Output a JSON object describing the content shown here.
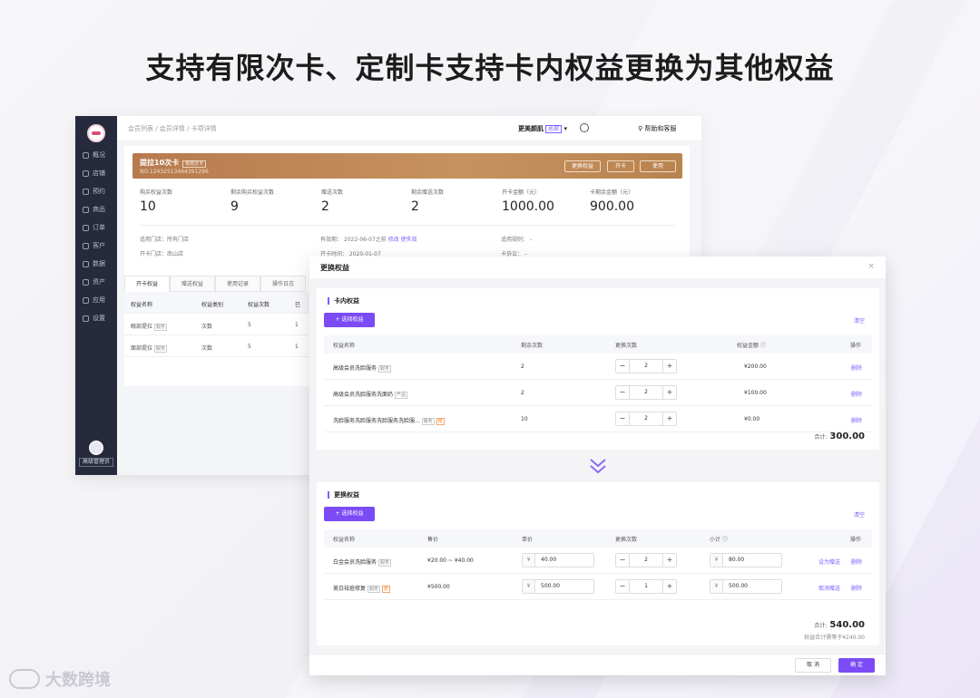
{
  "headline": "支持有限次卡、定制卡支持卡内权益更换为其他权益",
  "watermark": "大数跨境",
  "sidebar": {
    "items": [
      "概况",
      "店铺",
      "预约",
      "商品",
      "订单",
      "客户",
      "数据",
      "资产",
      "应用",
      "设置"
    ],
    "user_label": "高级管理员"
  },
  "topbar": {
    "breadcrumb": "会员列表 / 会员详情 / 卡项详情",
    "store_name": "更美颜肌",
    "store_tag": "总部",
    "help": "帮助和客服"
  },
  "card": {
    "title": "提拉10次卡",
    "tag": "有限次卡",
    "number": "NO.12432513464391296",
    "buttons": [
      "更换权益",
      "开卡",
      "使用"
    ],
    "stats": [
      {
        "label": "购买权益次数",
        "value": "10"
      },
      {
        "label": "剩余购买权益次数",
        "value": "9"
      },
      {
        "label": "赠送次数",
        "value": "2"
      },
      {
        "label": "剩余赠送次数",
        "value": "2"
      },
      {
        "label": "开卡金额（元）",
        "value": "1000.00"
      },
      {
        "label": "卡剩余金额（元）",
        "value": "900.00"
      }
    ],
    "info": {
      "applicable_store": "适用门店：所有门店",
      "open_store": "开卡门店：南山店",
      "validity": "有效期：   2022-06-07之前",
      "modify": "修改",
      "invalidate": "使失效",
      "open_time": "开卡时间：   2020-01-07",
      "rule": "适用规则：   –",
      "agreement": "卡协议：   –"
    },
    "tabs": [
      "开卡权益",
      "赠送权益",
      "使用记录",
      "操作日志"
    ],
    "table": {
      "headers": [
        "权益名称",
        "权益类别",
        "权益次数",
        "已"
      ],
      "rows": [
        {
          "name": "眼部提拉",
          "tag": "服务",
          "type": "次数",
          "count": "5",
          "used": "1"
        },
        {
          "name": "面部提拉",
          "tag": "服务",
          "type": "次数",
          "count": "5",
          "used": "1"
        }
      ]
    }
  },
  "modal": {
    "title": "更换权益",
    "close": "×",
    "in_card": {
      "title": "卡内权益",
      "add_label": "+ 选择权益",
      "clear_label": "清空",
      "headers": [
        "权益名称",
        "剩余次数",
        "更换次数",
        "权益金额",
        "操作"
      ],
      "rows": [
        {
          "name": "高级会员洗脸服务",
          "tag": "服务",
          "tag2": "",
          "remaining": "2",
          "qty": "2",
          "amount": "¥200.00",
          "op": "删除"
        },
        {
          "name": "高级会员洗脸服务洗面奶",
          "tag": "产品",
          "tag2": "",
          "remaining": "2",
          "qty": "2",
          "amount": "¥100.00",
          "op": "删除"
        },
        {
          "name": "洗脸服务洗脸服务洗脸服务洗脸服...",
          "tag": "服务",
          "tag2": "赠",
          "remaining": "10",
          "qty": "2",
          "amount": "¥0.00",
          "op": "删除"
        }
      ],
      "total_label": "合计:",
      "total_value": "300.00"
    },
    "replace": {
      "title": "更换权益",
      "add_label": "+ 选择权益",
      "clear_label": "清空",
      "headers": [
        "权益名称",
        "售价",
        "单价",
        "更换次数",
        "小计",
        "操作"
      ],
      "rows": [
        {
          "name": "白金会员洗脸服务",
          "tag": "服务",
          "tag2": "",
          "price": "¥20.00 ~ ¥40.00",
          "unit": "40.00",
          "qty": "2",
          "subtotal": "80.00",
          "op1": "设为赠送",
          "op2": "删除"
        },
        {
          "name": "美白祛痘修复",
          "tag": "服务",
          "tag2": "赠",
          "price": "¥500.00",
          "unit": "500.00",
          "qty": "1",
          "subtotal": "500.00",
          "op1": "取消赠送",
          "op2": "删除"
        }
      ],
      "currency": "¥",
      "total_label": "合计:",
      "total_value": "540.00",
      "total_note": "权益合计需等于¥240.00"
    },
    "cancel_label": "取 消",
    "confirm_label": "确 定"
  }
}
